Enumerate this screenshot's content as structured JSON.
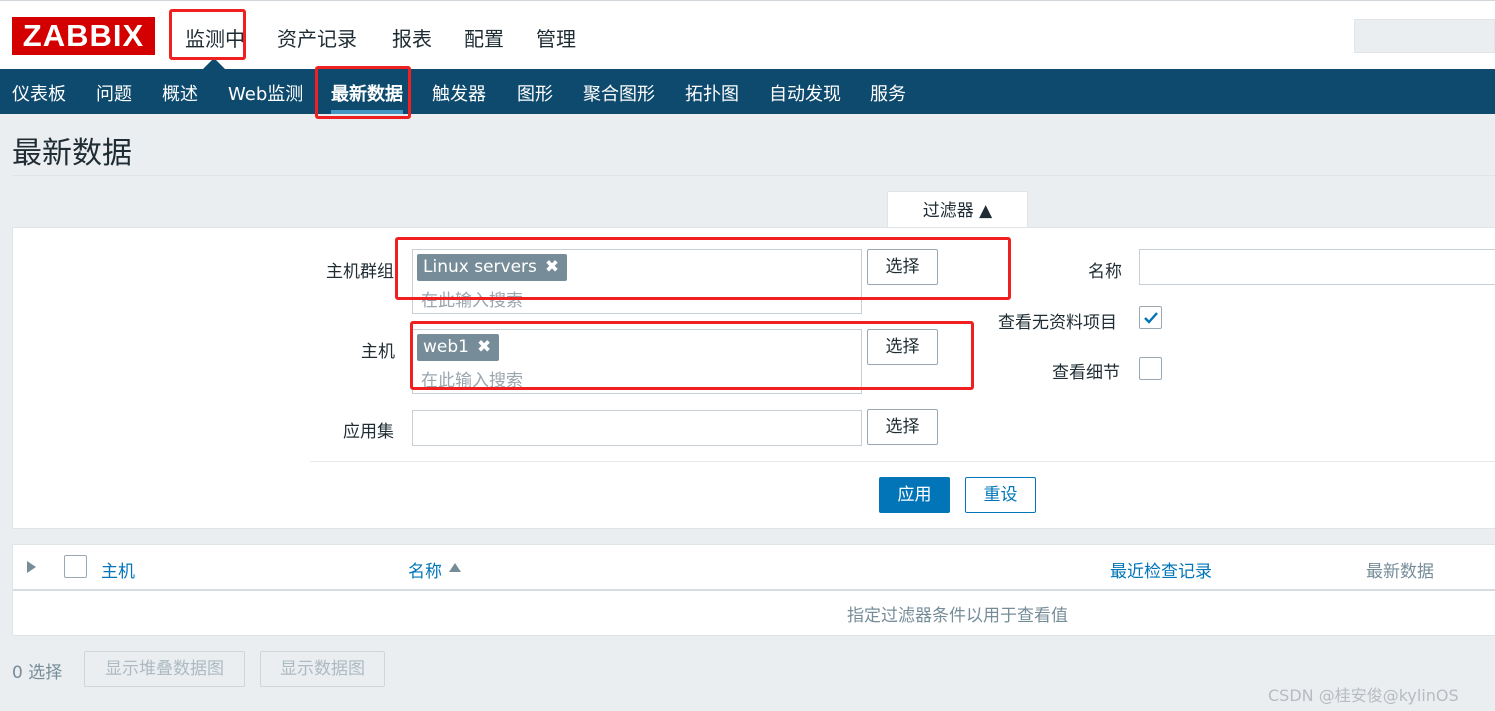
{
  "top": {
    "logo": "ZABBIX",
    "nav": [
      "监测中",
      "资产记录",
      "报表",
      "配置",
      "管理"
    ]
  },
  "subnav": [
    "仪表板",
    "问题",
    "概述",
    "Web监测",
    "最新数据",
    "触发器",
    "图形",
    "聚合图形",
    "拓扑图",
    "自动发现",
    "服务"
  ],
  "page": {
    "title": "最新数据"
  },
  "filter": {
    "tab_label": "过滤器 ▲",
    "host_groups": {
      "label": "主机群组",
      "tags": [
        "Linux servers"
      ],
      "placeholder": "在此输入搜索",
      "button": "选择"
    },
    "hosts": {
      "label": "主机",
      "tags": [
        "web1"
      ],
      "placeholder": "在此输入搜索",
      "button": "选择"
    },
    "application": {
      "label": "应用集",
      "value": "",
      "button": "选择"
    },
    "name": {
      "label": "名称",
      "value": ""
    },
    "show_without_data": {
      "label": "查看无资料项目",
      "checked": true
    },
    "show_details": {
      "label": "查看细节",
      "checked": false
    },
    "apply": "应用",
    "reset": "重设",
    "tag_close": "✖"
  },
  "table": {
    "columns": {
      "host": "主机",
      "name": "名称",
      "last_check": "最近检查记录",
      "last_value": "最新数据"
    },
    "empty_message": "指定过滤器条件以用于查看值"
  },
  "footer": {
    "selected": "0 选择",
    "stacked_graph": "显示堆叠数据图",
    "graph": "显示数据图"
  },
  "watermark": "CSDN @桂安俊@kylinOS",
  "colors": {
    "brand": "#d40000",
    "nav_bg": "#0e4a6e",
    "accent": "#0275b8",
    "highlight": "#f02020"
  }
}
